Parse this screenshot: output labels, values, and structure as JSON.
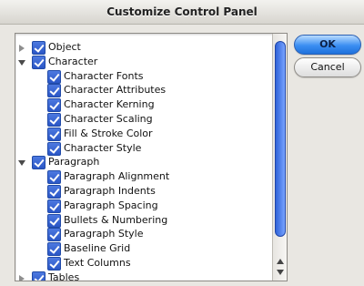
{
  "window": {
    "title": "Customize Control Panel"
  },
  "buttons": {
    "ok_label": "OK",
    "cancel_label": "Cancel"
  },
  "tree": {
    "items": [
      {
        "label": "Object",
        "level": 0,
        "expanded": false,
        "checked": true
      },
      {
        "label": "Character",
        "level": 0,
        "expanded": true,
        "checked": true
      },
      {
        "label": "Character Fonts",
        "level": 1,
        "checked": true
      },
      {
        "label": "Character Attributes",
        "level": 1,
        "checked": true
      },
      {
        "label": "Character Kerning",
        "level": 1,
        "checked": true
      },
      {
        "label": "Character Scaling",
        "level": 1,
        "checked": true
      },
      {
        "label": "Fill & Stroke Color",
        "level": 1,
        "checked": true
      },
      {
        "label": "Character Style",
        "level": 1,
        "checked": true
      },
      {
        "label": "Paragraph",
        "level": 0,
        "expanded": true,
        "checked": true
      },
      {
        "label": "Paragraph Alignment",
        "level": 1,
        "checked": true
      },
      {
        "label": "Paragraph Indents",
        "level": 1,
        "checked": true
      },
      {
        "label": "Paragraph Spacing",
        "level": 1,
        "checked": true
      },
      {
        "label": "Bullets & Numbering",
        "level": 1,
        "checked": true
      },
      {
        "label": "Paragraph Style",
        "level": 1,
        "checked": true
      },
      {
        "label": "Baseline Grid",
        "level": 1,
        "checked": true
      },
      {
        "label": "Text Columns",
        "level": 1,
        "checked": true
      },
      {
        "label": "Tables",
        "level": 0,
        "expanded": false,
        "checked": true
      }
    ]
  }
}
